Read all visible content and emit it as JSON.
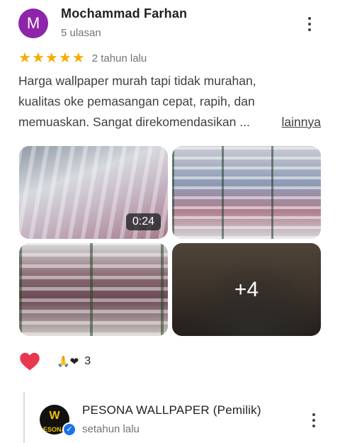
{
  "review": {
    "avatar_letter": "M",
    "avatar_color": "#8e24aa",
    "author_name": "Mochammad Farhan",
    "author_meta": "5 ulasan",
    "rating": 5,
    "star_glyph": "★",
    "star_color": "#f9ab00",
    "date": "2 tahun lalu",
    "text_lines": [
      "Harga wallpaper murah tapi tidak murahan,",
      "kualitas oke pemasangan cepat, rapih, dan",
      "memuaskan. Sangat direkomendasikan ..."
    ],
    "more_label": "lainnya"
  },
  "photos": {
    "video_duration": "0:24",
    "more_count": "+4"
  },
  "reactions": {
    "like_icon": "red-heart-icon",
    "summary_emojis": "🙏❤",
    "count": "3"
  },
  "owner_reply": {
    "logo_mark": "W",
    "logo_text": "ESONA",
    "name": "PESONA WALLPAPER (Pemilik)",
    "meta": "setahun lalu",
    "verified_icon": "verified-check-icon",
    "verified_glyph": "✓"
  }
}
